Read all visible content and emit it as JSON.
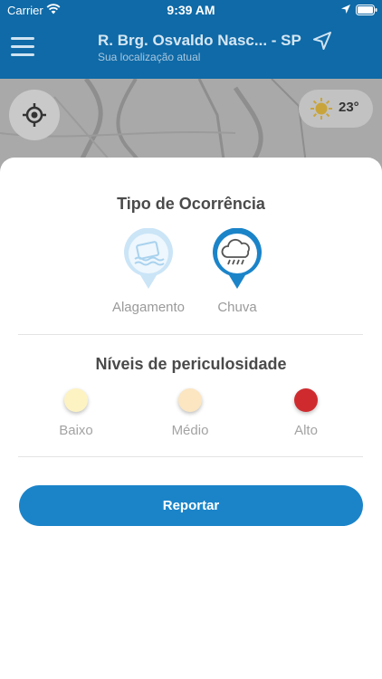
{
  "status_bar": {
    "carrier": "Carrier",
    "time": "9:39 AM"
  },
  "nav": {
    "title": "R. Brg. Osvaldo Nasc... - SP",
    "subtitle": "Sua localização atual",
    "menu_icon": "hamburger-menu-icon",
    "location_icon": "location-arrow-icon"
  },
  "weather": {
    "icon": "sun-cloud-icon",
    "temperature": "23°"
  },
  "occurrence": {
    "title": "Tipo de Ocorrência",
    "types": [
      {
        "label": "Alagamento",
        "icon": "flood-icon",
        "selected": false
      },
      {
        "label": "Chuva",
        "icon": "rain-cloud-icon",
        "selected": true
      }
    ]
  },
  "danger": {
    "title": "Níveis de periculosidade",
    "levels": [
      {
        "label": "Baixo",
        "color": "#fdf3c2"
      },
      {
        "label": "Médio",
        "color": "#fbe6c1"
      },
      {
        "label": "Alto",
        "color": "#cf2b2f"
      }
    ]
  },
  "actions": {
    "report_label": "Reportar"
  },
  "colors": {
    "header": "#0f6aa7",
    "accent": "#1b84c9",
    "pin_selected": "#1b84c9",
    "pin_unselected": "#b9dcf3"
  }
}
